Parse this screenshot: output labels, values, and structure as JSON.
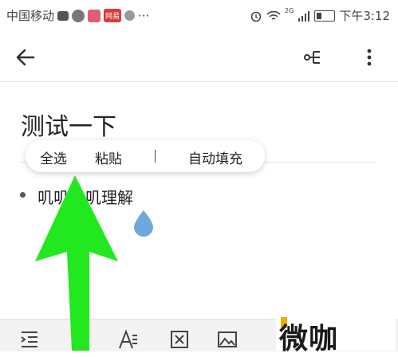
{
  "status_bar": {
    "carrier": "中国移动",
    "signal_label": "2G",
    "time": "下午3:12",
    "more": "···",
    "app_icon_label": "网易"
  },
  "app_bar": {
    "back_icon": "arrow-left-icon",
    "share_icon": "mind-map-icon",
    "more_icon": "more-vertical-icon"
  },
  "note": {
    "title": "测试一下",
    "bullet_text": "叽叽叽叽理解"
  },
  "context_menu": {
    "select_all": "全选",
    "paste": "粘贴",
    "separator": "|",
    "autofill": "自动填充"
  },
  "toolbar": {
    "items": [
      "indent-icon",
      "list-icon",
      "text-format-icon",
      "image-box-icon",
      "image-icon"
    ]
  },
  "watermark": {
    "text": "微咖"
  },
  "colors": {
    "arrow": "#22e81f",
    "handle": "#6fa8dc",
    "watermark_accent": "#f2a900"
  }
}
